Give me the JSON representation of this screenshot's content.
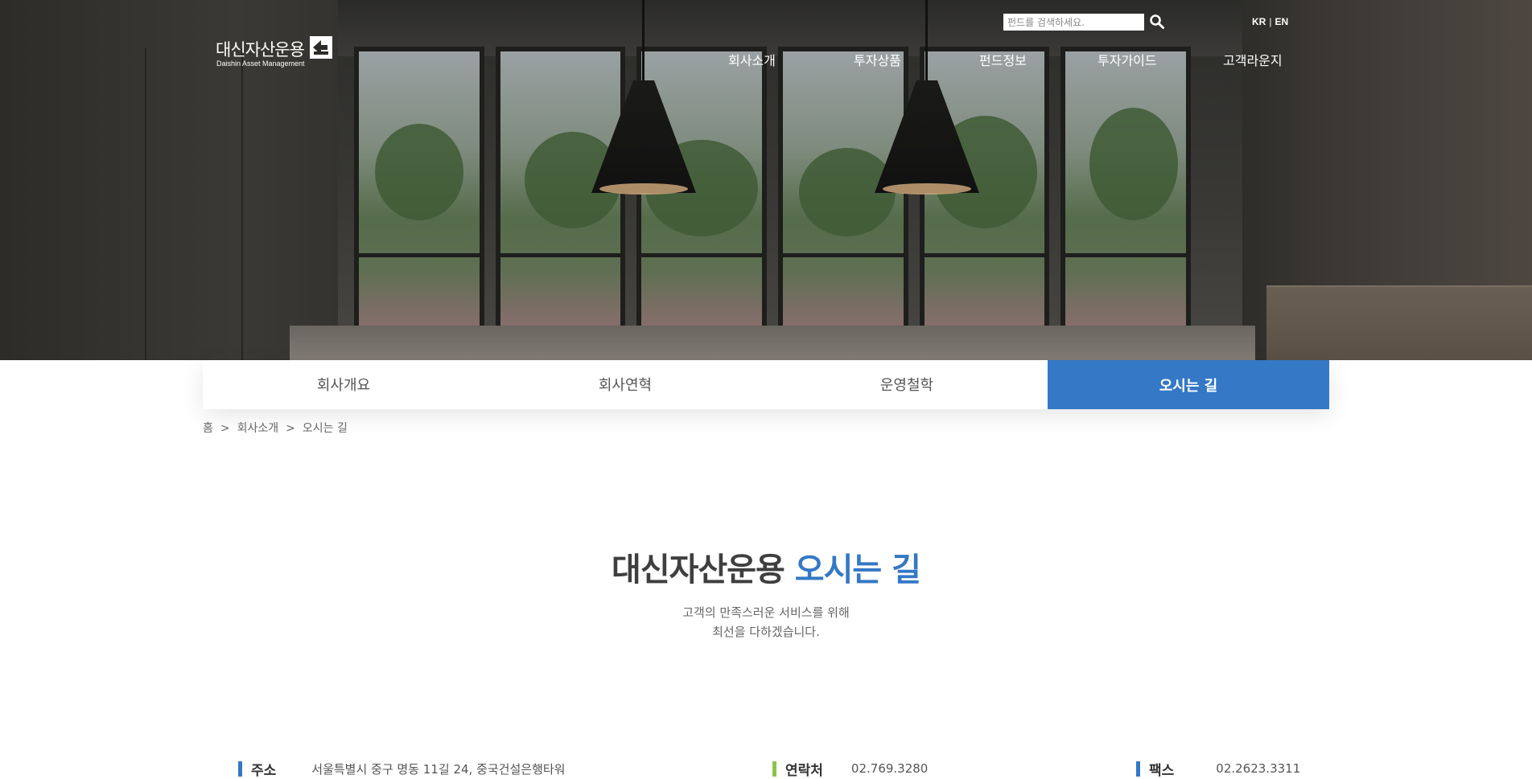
{
  "header": {
    "logo_kr": "대신자산운용",
    "logo_en": "Daishin Asset Management",
    "search_placeholder": "펀드를 검색하세요.",
    "lang_kr": "KR",
    "lang_sep": "|",
    "lang_en": "EN",
    "nav": [
      "회사소개",
      "투자상품",
      "펀드정보",
      "투자가이드",
      "고객라운지"
    ]
  },
  "subnav": {
    "tabs": [
      "회사개요",
      "회사연혁",
      "운영철학",
      "오시는 길"
    ],
    "active_index": 3
  },
  "breadcrumb": [
    "홈",
    "회사소개",
    "오시는 길"
  ],
  "breadcrumb_sep": ">",
  "main": {
    "title_main": "대신자산운용",
    "title_accent": "오시는 길",
    "subtitle_line1": "고객의 만족스러운 서비스를 위해",
    "subtitle_line2": "최선을 다하겠습니다."
  },
  "info": {
    "address_label": "주소",
    "address_value": "서울특별시 중구 명동 11길 24, 중국건설은행타워",
    "contact_label": "연락처",
    "contact_value": "02.769.3280",
    "fax_label": "팩스",
    "fax_value": "02.2623.3311"
  },
  "colors": {
    "accent": "#3478c6",
    "address_bar": "#3478c6",
    "contact_bar": "#8bc34a",
    "fax_bar": "#3478c6"
  },
  "icons": {
    "search": "search-icon",
    "logo_mark": "logo-mark-icon"
  }
}
